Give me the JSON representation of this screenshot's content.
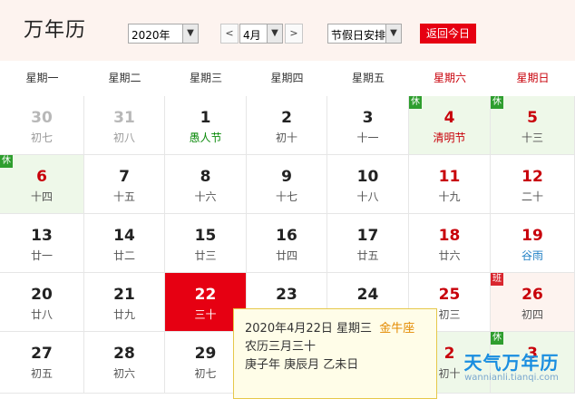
{
  "header": {
    "title": "万年历",
    "year_select": "2020年",
    "prev_month": "<",
    "month_select": "4月",
    "next_month": ">",
    "holiday_select": "节假日安排",
    "today_button": "返回今日"
  },
  "weekdays": [
    {
      "label": "星期一",
      "weekend": false
    },
    {
      "label": "星期二",
      "weekend": false
    },
    {
      "label": "星期三",
      "weekend": false
    },
    {
      "label": "星期四",
      "weekend": false
    },
    {
      "label": "星期五",
      "weekend": false
    },
    {
      "label": "星期六",
      "weekend": true
    },
    {
      "label": "星期日",
      "weekend": true
    }
  ],
  "days": [
    {
      "day": "30",
      "lunar": "初七",
      "other": true
    },
    {
      "day": "31",
      "lunar": "初八",
      "other": true
    },
    {
      "day": "1",
      "lunar": "愚人节",
      "lunar_type": "festival"
    },
    {
      "day": "2",
      "lunar": "初十"
    },
    {
      "day": "3",
      "lunar": "十一"
    },
    {
      "day": "4",
      "lunar": "清明节",
      "lunar_type": "holiday-name",
      "weekend": true,
      "badge": "休",
      "badge_type": "rest",
      "bg": "holiday"
    },
    {
      "day": "5",
      "lunar": "十三",
      "weekend": true,
      "badge": "休",
      "badge_type": "rest",
      "bg": "holiday"
    },
    {
      "day": "6",
      "lunar": "十四",
      "weekend": true,
      "badge": "休",
      "badge_type": "rest",
      "bg": "holiday"
    },
    {
      "day": "7",
      "lunar": "十五"
    },
    {
      "day": "8",
      "lunar": "十六"
    },
    {
      "day": "9",
      "lunar": "十七"
    },
    {
      "day": "10",
      "lunar": "十八"
    },
    {
      "day": "11",
      "lunar": "十九",
      "weekend": true
    },
    {
      "day": "12",
      "lunar": "二十",
      "weekend": true
    },
    {
      "day": "13",
      "lunar": "廿一"
    },
    {
      "day": "14",
      "lunar": "廿二"
    },
    {
      "day": "15",
      "lunar": "廿三"
    },
    {
      "day": "16",
      "lunar": "廿四"
    },
    {
      "day": "17",
      "lunar": "廿五"
    },
    {
      "day": "18",
      "lunar": "廿六",
      "weekend": true
    },
    {
      "day": "19",
      "lunar": "谷雨",
      "lunar_type": "solar-term",
      "weekend": true
    },
    {
      "day": "20",
      "lunar": "廿八"
    },
    {
      "day": "21",
      "lunar": "廿九"
    },
    {
      "day": "22",
      "lunar": "三十",
      "selected": true
    },
    {
      "day": "23",
      "lunar": ""
    },
    {
      "day": "24",
      "lunar": ""
    },
    {
      "day": "25",
      "lunar": "初三",
      "weekend": true
    },
    {
      "day": "26",
      "lunar": "初四",
      "weekend": true,
      "badge": "班",
      "badge_type": "work",
      "bg": "workday"
    },
    {
      "day": "27",
      "lunar": "初五"
    },
    {
      "day": "28",
      "lunar": "初六"
    },
    {
      "day": "29",
      "lunar": "初七"
    },
    {
      "day": "",
      "lunar": ""
    },
    {
      "day": "",
      "lunar": ""
    },
    {
      "day": "2",
      "lunar": "初十",
      "weekend": true,
      "badge": "休",
      "badge_type": "rest",
      "bg": "holiday"
    },
    {
      "day": "3",
      "lunar": "",
      "weekend": true,
      "badge": "休",
      "badge_type": "rest",
      "bg": "holiday"
    }
  ],
  "popup": {
    "date_line": "2020年4月22日 星期三",
    "zodiac": "金牛座",
    "lunar_line": "农历三月三十",
    "ganzhi_line": "庚子年 庚辰月 乙未日"
  },
  "watermark": {
    "brand": "天气万年历",
    "url": "wannianli.tianqi.com"
  }
}
